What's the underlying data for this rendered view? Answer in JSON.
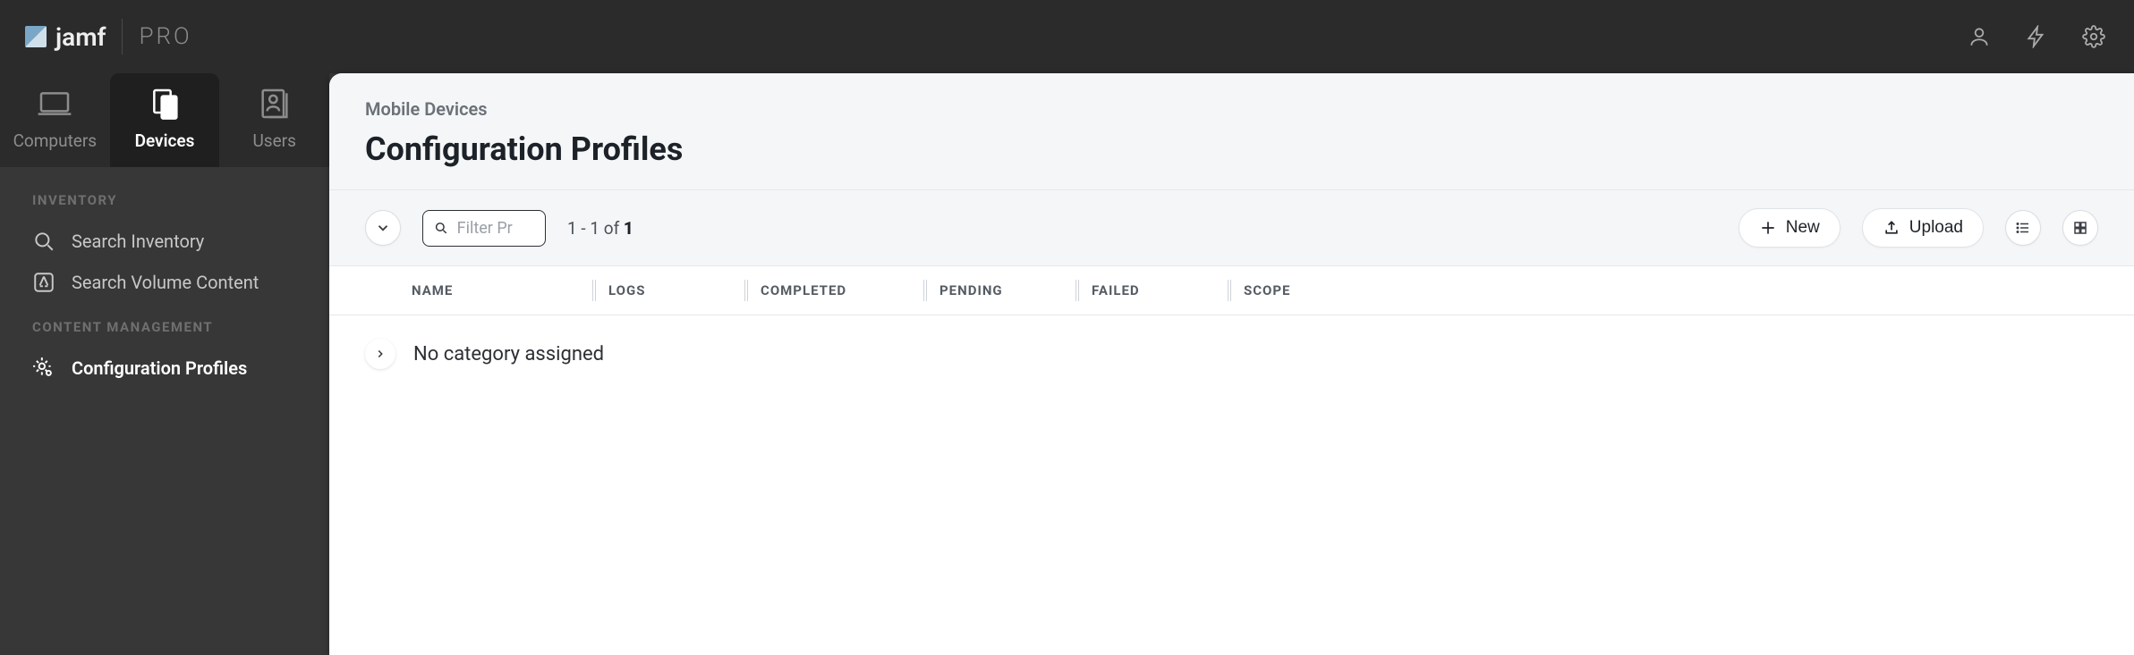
{
  "brand": {
    "name": "jamf",
    "suffix": "PRO"
  },
  "nav_tabs": {
    "computers": "Computers",
    "devices": "Devices",
    "users": "Users"
  },
  "sidebar": {
    "section_inventory": "INVENTORY",
    "search_inventory": "Search Inventory",
    "search_volume_content": "Search Volume Content",
    "section_content": "CONTENT MANAGEMENT",
    "configuration_profiles": "Configuration Profiles"
  },
  "page": {
    "crumb": "Mobile Devices",
    "title": "Configuration Profiles"
  },
  "toolbar": {
    "filter_placeholder": "Filter Pr",
    "count_prefix": "1 - 1 of ",
    "count_total": "1",
    "new_label": "New",
    "upload_label": "Upload"
  },
  "table": {
    "headers": {
      "name": "NAME",
      "logs": "LOGS",
      "completed": "COMPLETED",
      "pending": "PENDING",
      "failed": "FAILED",
      "scope": "SCOPE"
    },
    "group_no_category": "No category assigned"
  }
}
